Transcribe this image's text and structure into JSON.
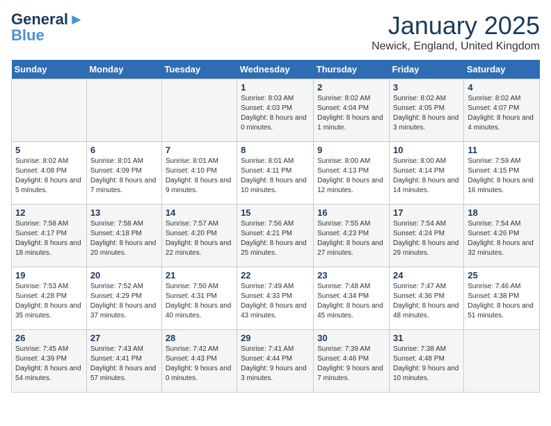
{
  "header": {
    "logo_line1": "General",
    "logo_line2": "Blue",
    "month_title": "January 2025",
    "location": "Newick, England, United Kingdom"
  },
  "weekdays": [
    "Sunday",
    "Monday",
    "Tuesday",
    "Wednesday",
    "Thursday",
    "Friday",
    "Saturday"
  ],
  "weeks": [
    [
      {
        "day": "",
        "sunrise": "",
        "sunset": "",
        "daylight": ""
      },
      {
        "day": "",
        "sunrise": "",
        "sunset": "",
        "daylight": ""
      },
      {
        "day": "",
        "sunrise": "",
        "sunset": "",
        "daylight": ""
      },
      {
        "day": "1",
        "sunrise": "Sunrise: 8:03 AM",
        "sunset": "Sunset: 4:03 PM",
        "daylight": "Daylight: 8 hours and 0 minutes."
      },
      {
        "day": "2",
        "sunrise": "Sunrise: 8:02 AM",
        "sunset": "Sunset: 4:04 PM",
        "daylight": "Daylight: 8 hours and 1 minute."
      },
      {
        "day": "3",
        "sunrise": "Sunrise: 8:02 AM",
        "sunset": "Sunset: 4:05 PM",
        "daylight": "Daylight: 8 hours and 3 minutes."
      },
      {
        "day": "4",
        "sunrise": "Sunrise: 8:02 AM",
        "sunset": "Sunset: 4:07 PM",
        "daylight": "Daylight: 8 hours and 4 minutes."
      }
    ],
    [
      {
        "day": "5",
        "sunrise": "Sunrise: 8:02 AM",
        "sunset": "Sunset: 4:08 PM",
        "daylight": "Daylight: 8 hours and 5 minutes."
      },
      {
        "day": "6",
        "sunrise": "Sunrise: 8:01 AM",
        "sunset": "Sunset: 4:09 PM",
        "daylight": "Daylight: 8 hours and 7 minutes."
      },
      {
        "day": "7",
        "sunrise": "Sunrise: 8:01 AM",
        "sunset": "Sunset: 4:10 PM",
        "daylight": "Daylight: 8 hours and 9 minutes."
      },
      {
        "day": "8",
        "sunrise": "Sunrise: 8:01 AM",
        "sunset": "Sunset: 4:11 PM",
        "daylight": "Daylight: 8 hours and 10 minutes."
      },
      {
        "day": "9",
        "sunrise": "Sunrise: 8:00 AM",
        "sunset": "Sunset: 4:13 PM",
        "daylight": "Daylight: 8 hours and 12 minutes."
      },
      {
        "day": "10",
        "sunrise": "Sunrise: 8:00 AM",
        "sunset": "Sunset: 4:14 PM",
        "daylight": "Daylight: 8 hours and 14 minutes."
      },
      {
        "day": "11",
        "sunrise": "Sunrise: 7:59 AM",
        "sunset": "Sunset: 4:15 PM",
        "daylight": "Daylight: 8 hours and 16 minutes."
      }
    ],
    [
      {
        "day": "12",
        "sunrise": "Sunrise: 7:58 AM",
        "sunset": "Sunset: 4:17 PM",
        "daylight": "Daylight: 8 hours and 18 minutes."
      },
      {
        "day": "13",
        "sunrise": "Sunrise: 7:58 AM",
        "sunset": "Sunset: 4:18 PM",
        "daylight": "Daylight: 8 hours and 20 minutes."
      },
      {
        "day": "14",
        "sunrise": "Sunrise: 7:57 AM",
        "sunset": "Sunset: 4:20 PM",
        "daylight": "Daylight: 8 hours and 22 minutes."
      },
      {
        "day": "15",
        "sunrise": "Sunrise: 7:56 AM",
        "sunset": "Sunset: 4:21 PM",
        "daylight": "Daylight: 8 hours and 25 minutes."
      },
      {
        "day": "16",
        "sunrise": "Sunrise: 7:55 AM",
        "sunset": "Sunset: 4:23 PM",
        "daylight": "Daylight: 8 hours and 27 minutes."
      },
      {
        "day": "17",
        "sunrise": "Sunrise: 7:54 AM",
        "sunset": "Sunset: 4:24 PM",
        "daylight": "Daylight: 8 hours and 29 minutes."
      },
      {
        "day": "18",
        "sunrise": "Sunrise: 7:54 AM",
        "sunset": "Sunset: 4:26 PM",
        "daylight": "Daylight: 8 hours and 32 minutes."
      }
    ],
    [
      {
        "day": "19",
        "sunrise": "Sunrise: 7:53 AM",
        "sunset": "Sunset: 4:28 PM",
        "daylight": "Daylight: 8 hours and 35 minutes."
      },
      {
        "day": "20",
        "sunrise": "Sunrise: 7:52 AM",
        "sunset": "Sunset: 4:29 PM",
        "daylight": "Daylight: 8 hours and 37 minutes."
      },
      {
        "day": "21",
        "sunrise": "Sunrise: 7:50 AM",
        "sunset": "Sunset: 4:31 PM",
        "daylight": "Daylight: 8 hours and 40 minutes."
      },
      {
        "day": "22",
        "sunrise": "Sunrise: 7:49 AM",
        "sunset": "Sunset: 4:33 PM",
        "daylight": "Daylight: 8 hours and 43 minutes."
      },
      {
        "day": "23",
        "sunrise": "Sunrise: 7:48 AM",
        "sunset": "Sunset: 4:34 PM",
        "daylight": "Daylight: 8 hours and 45 minutes."
      },
      {
        "day": "24",
        "sunrise": "Sunrise: 7:47 AM",
        "sunset": "Sunset: 4:36 PM",
        "daylight": "Daylight: 8 hours and 48 minutes."
      },
      {
        "day": "25",
        "sunrise": "Sunrise: 7:46 AM",
        "sunset": "Sunset: 4:38 PM",
        "daylight": "Daylight: 8 hours and 51 minutes."
      }
    ],
    [
      {
        "day": "26",
        "sunrise": "Sunrise: 7:45 AM",
        "sunset": "Sunset: 4:39 PM",
        "daylight": "Daylight: 8 hours and 54 minutes."
      },
      {
        "day": "27",
        "sunrise": "Sunrise: 7:43 AM",
        "sunset": "Sunset: 4:41 PM",
        "daylight": "Daylight: 8 hours and 57 minutes."
      },
      {
        "day": "28",
        "sunrise": "Sunrise: 7:42 AM",
        "sunset": "Sunset: 4:43 PM",
        "daylight": "Daylight: 9 hours and 0 minutes."
      },
      {
        "day": "29",
        "sunrise": "Sunrise: 7:41 AM",
        "sunset": "Sunset: 4:44 PM",
        "daylight": "Daylight: 9 hours and 3 minutes."
      },
      {
        "day": "30",
        "sunrise": "Sunrise: 7:39 AM",
        "sunset": "Sunset: 4:46 PM",
        "daylight": "Daylight: 9 hours and 7 minutes."
      },
      {
        "day": "31",
        "sunrise": "Sunrise: 7:38 AM",
        "sunset": "Sunset: 4:48 PM",
        "daylight": "Daylight: 9 hours and 10 minutes."
      },
      {
        "day": "",
        "sunrise": "",
        "sunset": "",
        "daylight": ""
      }
    ]
  ]
}
